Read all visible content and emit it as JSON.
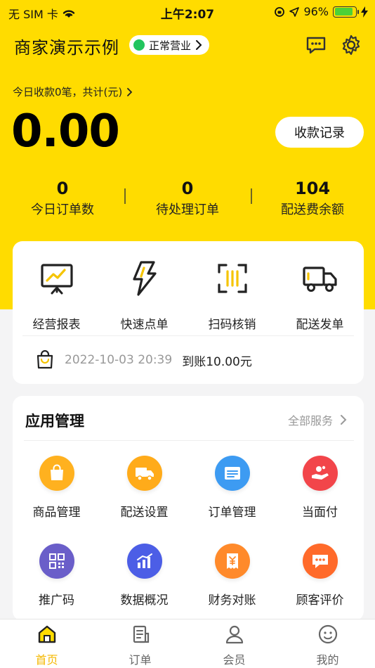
{
  "status_bar": {
    "carrier": "无 SIM 卡",
    "time": "上午2:07",
    "battery": "96%"
  },
  "header": {
    "shop_name": "商家演示示例",
    "status": "正常营业"
  },
  "summary": {
    "today_text": "今日收款0笔，共计(元)",
    "amount": "0.00",
    "records_button": "收款记录"
  },
  "stats": [
    {
      "value": "0",
      "label": "今日订单数"
    },
    {
      "value": "0",
      "label": "待处理订单"
    },
    {
      "value": "104",
      "label": "配送费余额"
    }
  ],
  "quick_actions": [
    {
      "label": "经营报表",
      "icon": "report-board-icon"
    },
    {
      "label": "快速点单",
      "icon": "lightning-icon"
    },
    {
      "label": "扫码核销",
      "icon": "scan-icon"
    },
    {
      "label": "配送发单",
      "icon": "truck-icon"
    }
  ],
  "notice": {
    "date": "2022-10-03 20:39",
    "message": "到账10.00元"
  },
  "app_management": {
    "title": "应用管理",
    "all_services": "全部服务",
    "apps": [
      {
        "label": "商品管理",
        "icon": "shopping-bag-icon",
        "color": "#ffb11f"
      },
      {
        "label": "配送设置",
        "icon": "delivery-truck-icon",
        "color": "#ffab1a"
      },
      {
        "label": "订单管理",
        "icon": "order-list-icon",
        "color": "#3d9bf2"
      },
      {
        "label": "当面付",
        "icon": "hand-coin-icon",
        "color": "#f2454a"
      },
      {
        "label": "推广码",
        "icon": "qr-code-icon",
        "color": "#6a5ec9"
      },
      {
        "label": "数据概况",
        "icon": "bar-chart-icon",
        "color": "#4c5ee6"
      },
      {
        "label": "财务对账",
        "icon": "finance-receipt-icon",
        "color": "#ff8a2b"
      },
      {
        "label": "顾客评价",
        "icon": "comment-icon",
        "color": "#ff6a2a"
      }
    ]
  },
  "tabbar": [
    {
      "label": "首页",
      "icon": "home-icon",
      "active": true
    },
    {
      "label": "订单",
      "icon": "order-icon",
      "active": false
    },
    {
      "label": "会员",
      "icon": "member-icon",
      "active": false
    },
    {
      "label": "我的",
      "icon": "profile-icon",
      "active": false
    }
  ],
  "colors": {
    "brand_yellow": "#ffdc00",
    "active_tab": "#f5b800",
    "open_status": "#22c55e"
  }
}
